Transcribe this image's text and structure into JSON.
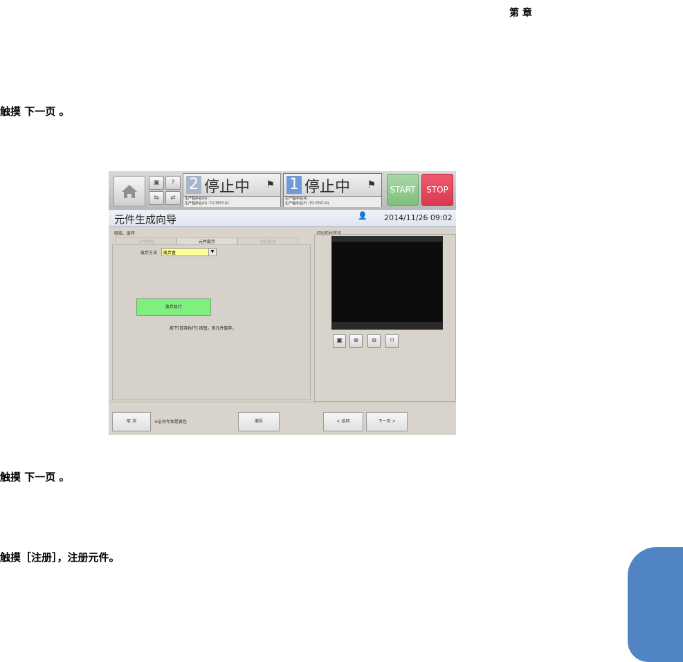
{
  "header": {
    "chapter_label": "第 章"
  },
  "steps": [
    {
      "text": "触摸 下一页 。"
    },
    {
      "text": "触摸 下一页 。"
    },
    {
      "text": "触摸［注册］，注册元件。"
    }
  ],
  "screen": {
    "topbar": {
      "lane2": {
        "number": "2",
        "status": "停止中",
        "program_line1": "生产程序名(R) :",
        "program_line2": "生产程序名(R) :TO-TEST-01"
      },
      "lane1": {
        "number": "1",
        "status": "停止中",
        "program_line1": "生产程序名(R) :",
        "program_line2": "生产程序名(F) :TO-TEST-01"
      },
      "start_label": "START",
      "stop_label": "STOP"
    },
    "title": "元件生成向导",
    "datetime": "2014/11/26 09:02",
    "left_panel": {
      "heading": "吸取、废弃",
      "tabs": [
        {
          "label": "元件吸取"
        },
        {
          "label": "元件废弃"
        },
        {
          "label": "识别处理"
        }
      ],
      "discard_method_label": "废弃方法",
      "discard_method_value": "废弃盒",
      "exec_button": "放弃执行",
      "hint": "按下[放弃执行] 按钮，则元件废弃。"
    },
    "right_panel": {
      "heading": "识别形状资讯"
    },
    "bottom": {
      "cancel": "取 消",
      "note": "※必须专案是黄色",
      "retry": "撤拆",
      "back": "< 返回",
      "next": "下一页 >"
    }
  }
}
